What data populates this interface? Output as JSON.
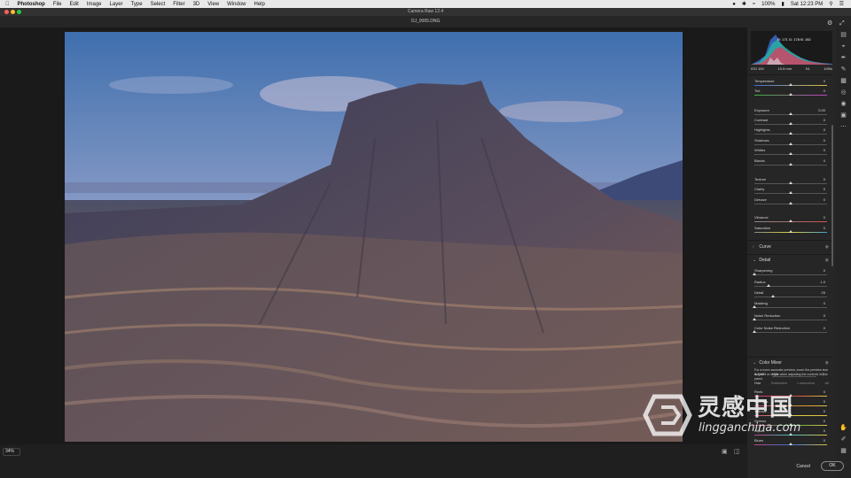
{
  "menubar": {
    "items": [
      "Photoshop",
      "File",
      "Edit",
      "Image",
      "Layer",
      "Type",
      "Select",
      "Filter",
      "3D",
      "View",
      "Window",
      "Help"
    ],
    "battery": "100%",
    "clock": "Sat 12:23 PM"
  },
  "window": {
    "title": "Camera Raw 12.4"
  },
  "document": {
    "filename": "OJ_0065.DNG"
  },
  "histogram": {
    "r": "R: 171",
    "g": "G: 178",
    "b": "B: 192"
  },
  "exif": {
    "iso": "ISO 100",
    "focal": "10.5 mm",
    "aperture": "f/4",
    "shutter": "1/80s"
  },
  "basic": [
    {
      "label": "Temperature",
      "value": "0",
      "pos": 0.5
    },
    {
      "label": "Tint",
      "value": "0",
      "pos": 0.5
    },
    {
      "label": "Exposure",
      "value": "0.00",
      "pos": 0.5
    },
    {
      "label": "Contrast",
      "value": "0",
      "pos": 0.5
    },
    {
      "label": "Highlights",
      "value": "0",
      "pos": 0.5
    },
    {
      "label": "Shadows",
      "value": "0",
      "pos": 0.5
    },
    {
      "label": "Whites",
      "value": "0",
      "pos": 0.5
    },
    {
      "label": "Blacks",
      "value": "0",
      "pos": 0.5
    },
    {
      "label": "Texture",
      "value": "0",
      "pos": 0.5
    },
    {
      "label": "Clarity",
      "value": "0",
      "pos": 0.5
    },
    {
      "label": "Dehaze",
      "value": "0",
      "pos": 0.5
    },
    {
      "label": "Vibrance",
      "value": "0",
      "pos": 0.5
    },
    {
      "label": "Saturation",
      "value": "0",
      "pos": 0.5
    }
  ],
  "sections": {
    "curve": "Curve",
    "detail": "Detail",
    "color_mixer": "Color Mixer"
  },
  "detail": [
    {
      "label": "Sharpening",
      "value": "0",
      "pos": 0.0
    },
    {
      "label": "Radius",
      "value": "1.0",
      "pos": 0.2
    },
    {
      "label": "Detail",
      "value": "25",
      "pos": 0.25
    },
    {
      "label": "Masking",
      "value": "0",
      "pos": 0.0
    },
    {
      "label": "Noise Reduction",
      "value": "0",
      "pos": 0.0
    },
    {
      "label": "Color Noise Reduction",
      "value": "0",
      "pos": 0.0
    }
  ],
  "detail_note": "For a more accurate preview, zoom the preview size to 100% or larger when adjusting the controls in this panel.",
  "mixer": {
    "adjust_label": "Adjust",
    "adjust_value": "HSL",
    "tabs": [
      "Hue",
      "Saturation",
      "Luminance",
      "All"
    ],
    "rows": [
      {
        "label": "Reds",
        "value": "0"
      },
      {
        "label": "Oranges",
        "value": "0"
      },
      {
        "label": "Yellows",
        "value": "0"
      },
      {
        "label": "Greens",
        "value": "0"
      },
      {
        "label": "Aquas",
        "value": "0"
      },
      {
        "label": "Blues",
        "value": "0"
      }
    ]
  },
  "zoom": "34%",
  "buttons": {
    "cancel": "Cancel",
    "ok": "OK"
  },
  "watermark": {
    "cn": "灵感中国",
    "en": "lingganchina.com"
  }
}
